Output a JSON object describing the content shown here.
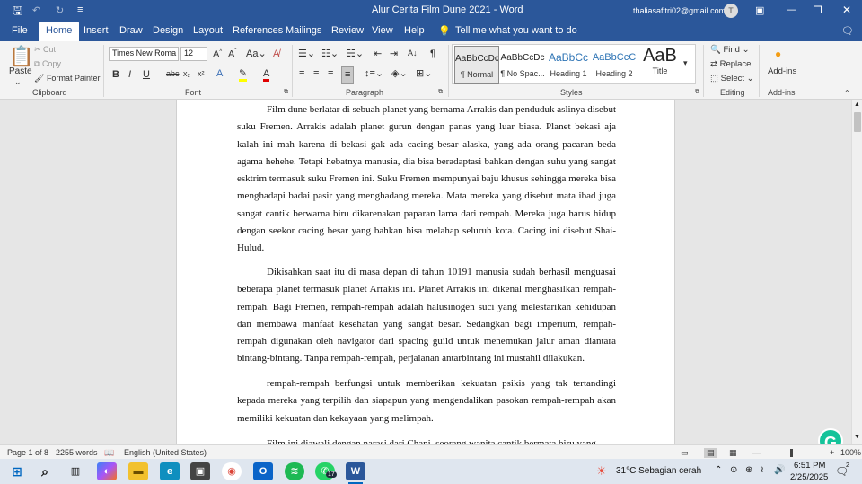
{
  "titlebar": {
    "doc_title": "Alur Cerita Film Dune 2021  -  Word",
    "user_email": "thaliasafitri02@gmail.com",
    "avatar_letter": "T"
  },
  "menu": {
    "tabs": [
      "File",
      "Home",
      "Insert",
      "Draw",
      "Design",
      "Layout",
      "References",
      "Mailings",
      "Review",
      "View",
      "Help"
    ],
    "tell_me": "Tell me what you want to do"
  },
  "ribbon": {
    "clipboard": {
      "paste": "Paste",
      "cut": "Cut",
      "copy": "Copy",
      "format_painter": "Format Painter",
      "label": "Clipboard"
    },
    "font": {
      "family": "Times New Roma",
      "size": "12",
      "label": "Font"
    },
    "paragraph": {
      "label": "Paragraph"
    },
    "styles": {
      "label": "Styles",
      "items": [
        {
          "preview": "AaBbCcDc",
          "name": "¶ Normal"
        },
        {
          "preview": "AaBbCcDc",
          "name": "¶ No Spac..."
        },
        {
          "preview": "AaBbCc",
          "name": "Heading 1"
        },
        {
          "preview": "AaBbCcC",
          "name": "Heading 2"
        },
        {
          "preview": "AaB",
          "name": "Title"
        }
      ]
    },
    "editing": {
      "find": "Find",
      "replace": "Replace",
      "select": "Select",
      "label": "Editing"
    },
    "addins": {
      "button": "Add-ins",
      "label": "Add-ins"
    }
  },
  "document": {
    "paragraphs": [
      "Film dune berlatar di sebuah planet yang bernama Arrakis dan penduduk aslinya disebut suku Fremen. Arrakis adalah planet gurun dengan panas yang luar biasa. Planet bekasi aja kalah ini mah karena di bekasi gak ada cacing besar alaska, yang ada orang pacaran beda agama hehehe. Tetapi hebatnya manusia, dia bisa beradaptasi bahkan dengan suhu yang sangat esktrim termasuk suku Fremen ini. Suku Fremen mempunyai baju khusus sehingga mereka bisa menghadapi badai pasir yang menghadang mereka. Mata mereka yang disebut mata ibad juga sangat cantik berwarna biru dikarenakan paparan lama dari rempah. Mereka juga harus hidup dengan seekor cacing besar yang bahkan bisa melahap seluruh kota. Cacing ini disebut Shai-Hulud.",
      "Dikisahkan saat itu di masa depan di tahun 10191 manusia sudah berhasil menguasai beberapa planet termasuk planet Arrakis ini. Planet Arrakis ini dikenal menghasilkan rempah-rempah. Bagi Fremen, rempah-rempah adalah halusinogen suci yang melestarikan kehidupan dan membawa manfaat kesehatan yang sangat besar. Sedangkan bagi imperium, rempah-rempah digunakan oleh navigator dari spacing guild untuk menemukan jalur aman diantara bintang-bintang. Tanpa rempah-rempah, perjalanan antarbintang ini mustahil dilakukan.",
      "rempah-rempah berfungsi untuk memberikan kekuatan psikis yang tak tertandingi kepada mereka yang terpilih dan siapapun yang mengendalikan pasokan rempah-rempah akan memiliki kekuatan dan kekayaan yang melimpah.",
      "Film ini diawali dengan narasi dari Chani, seorang wanita cantik bermata biru yang"
    ]
  },
  "status": {
    "page": "Page 1 of 8",
    "words": "2255 words",
    "language": "English (United States)",
    "zoom": "100%"
  },
  "taskbar": {
    "weather": "31°C  Sebagian cerah",
    "time": "6:51 PM",
    "date": "2/25/2025",
    "whatsapp_badge": "17",
    "notif_count": "2"
  },
  "colors": {
    "word_blue": "#2b579a",
    "grammarly_green": "#15c39a"
  }
}
